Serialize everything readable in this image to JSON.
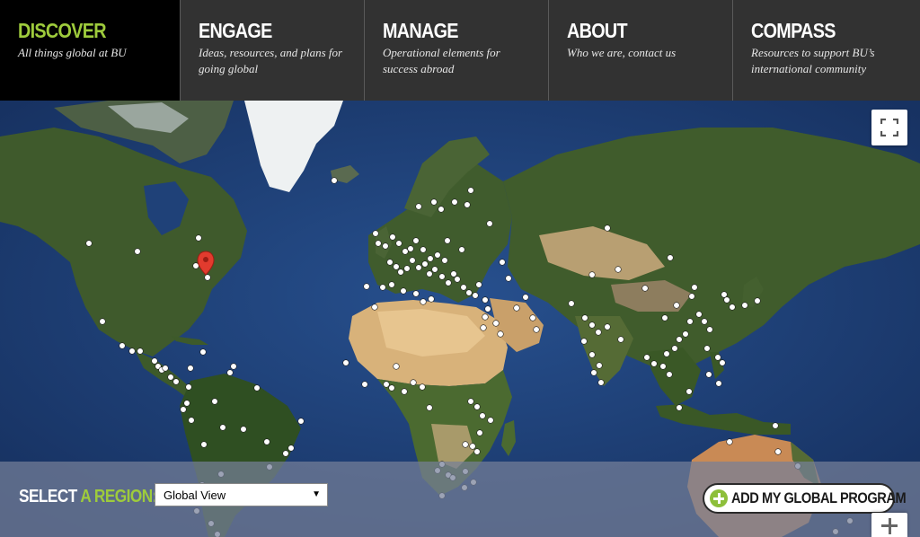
{
  "nav": {
    "items": [
      {
        "title": "DISCOVER",
        "subtitle": "All things global at BU",
        "active": true
      },
      {
        "title": "ENGAGE",
        "subtitle": "Ideas, resources, and plans for going global",
        "active": false
      },
      {
        "title": "MANAGE",
        "subtitle": "Operational elements for success abroad",
        "active": false
      },
      {
        "title": "ABOUT",
        "subtitle": "Who we are, contact us",
        "active": false
      },
      {
        "title": "COMPASS",
        "subtitle": "Resources to support BU’s international community",
        "active": false
      }
    ]
  },
  "map": {
    "icons": {
      "fullscreen": "fullscreen-icon",
      "zoom_in": "zoom-in-icon",
      "home_marker": "map-pin-icon",
      "program_marker": "location-dot"
    },
    "colors": {
      "ocean": "#1f3f78",
      "land": "#3f5a2c",
      "desert": "#d8b27a",
      "ice": "#f4f6f7",
      "marker": "#ffffff",
      "pin": "#e23b2e"
    }
  },
  "region": {
    "label_prefix": "SELECT",
    "label_accent": "A REGION:",
    "selected": "Global View",
    "caret": "▼"
  },
  "actions": {
    "add_program": "ADD MY GLOBAL PROGRAM"
  },
  "theme": {
    "accent": "#9ecb3c",
    "nav_bg": "#323232",
    "nav_active_bg": "#000000"
  }
}
